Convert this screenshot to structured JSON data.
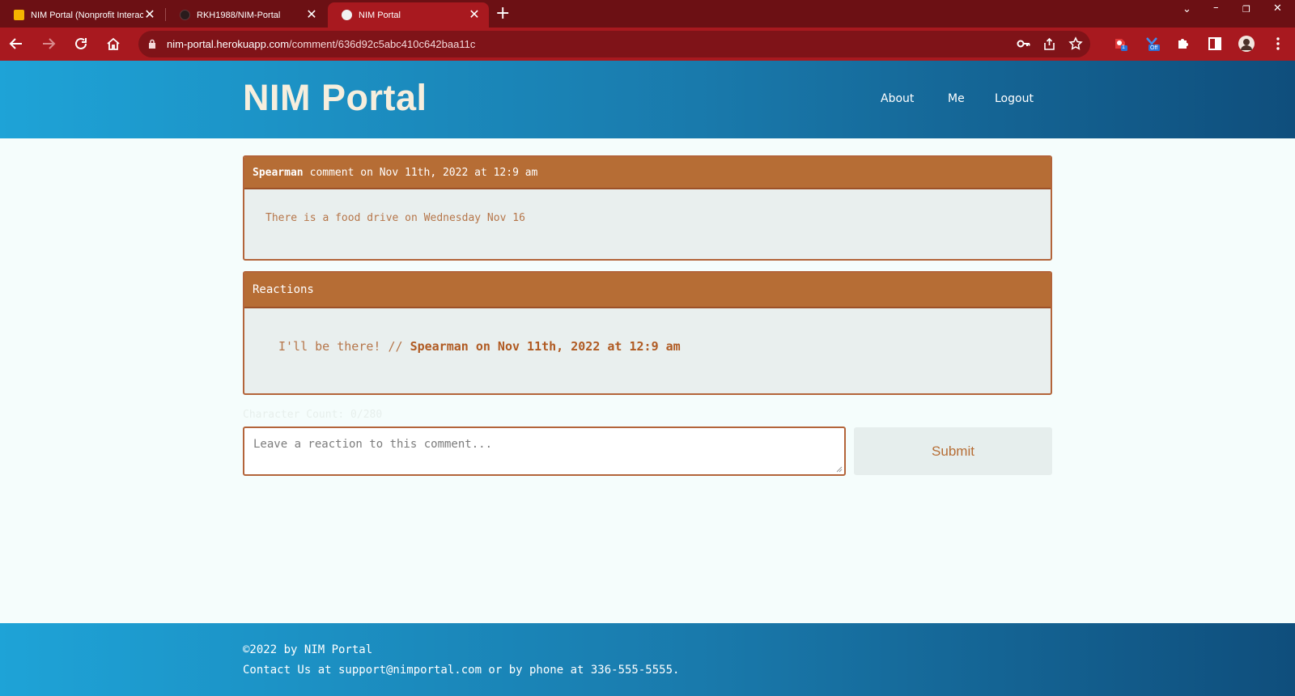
{
  "browser": {
    "tabs": [
      {
        "title": "NIM Portal (Nonprofit Interacti",
        "favicon": "notes-favicon-icon",
        "active": false
      },
      {
        "title": "RKH1988/NIM-Portal",
        "favicon": "github-favicon-icon",
        "active": false
      },
      {
        "title": "NIM Portal",
        "favicon": "page-favicon-icon",
        "active": true
      }
    ],
    "url_host": "nim-portal.herokuapp.com",
    "url_path": "/comment/636d92c5abc410c642baa11c",
    "extension_badges": {
      "badge_one": "1",
      "badge_off": "Off"
    }
  },
  "header": {
    "brand": "NIM Portal",
    "nav": [
      {
        "label": "About"
      },
      {
        "label": "Me"
      },
      {
        "label": "Logout"
      }
    ]
  },
  "comment": {
    "author": "Spearman",
    "meta": "comment on Nov 11th, 2022 at 12:9 am",
    "text": "There is a food drive on Wednesday Nov 16"
  },
  "reactions": {
    "heading": "Reactions",
    "items": [
      {
        "text": "I'll be there! //",
        "byline": "Spearman on Nov 11th, 2022 at 12:9 am"
      }
    ]
  },
  "reaction_form": {
    "char_count": "Character Count: 0/280",
    "placeholder": "Leave a reaction to this comment...",
    "submit_label": "Submit"
  },
  "footer": {
    "copyright": "©2022 by NIM Portal",
    "contact": "Contact Us at support@nimportal.com or by phone at 336-555-5555."
  },
  "colors": {
    "tabbar": "#6c1014",
    "toolbar": "#a8191f",
    "header_gradient_start": "#1ea3d7",
    "header_gradient_end": "#0f4e7c",
    "accent_brown": "#b66d35",
    "card_body": "#e9efee",
    "page_bg": "#f5fdfc"
  }
}
